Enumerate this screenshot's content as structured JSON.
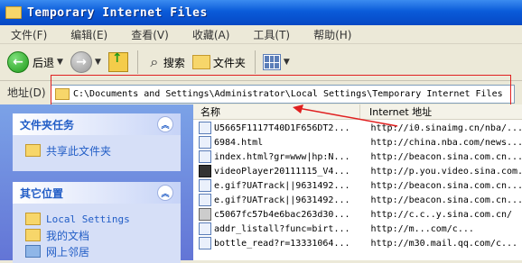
{
  "window": {
    "title": "Temporary Internet Files"
  },
  "menu": [
    "文件(F)",
    "编辑(E)",
    "查看(V)",
    "收藏(A)",
    "工具(T)",
    "帮助(H)"
  ],
  "toolbar": {
    "back_label": "后退",
    "search_label": "搜索",
    "folders_label": "文件夹"
  },
  "address": {
    "label": "地址(D)",
    "path": "C:\\Documents and Settings\\Administrator\\Local Settings\\Temporary Internet Files"
  },
  "tasks": {
    "title": "文件夹任务",
    "items": [
      "共享此文件夹"
    ]
  },
  "places": {
    "title": "其它位置",
    "items": [
      "Local Settings",
      "我的文档",
      "网上邻居"
    ]
  },
  "files": {
    "columns": [
      "名称",
      "Internet 地址"
    ],
    "rows": [
      {
        "name": "U5665F1117T40D1F656DT2...",
        "addr": "http://i0.sinaimg.cn/nba/..."
      },
      {
        "name": "6984.html",
        "addr": "http://china.nba.com/news..."
      },
      {
        "name": "index.html?gr=www|hp:N...",
        "addr": "http://beacon.sina.com.cn..."
      },
      {
        "name": "videoPlayer20111115_V4...",
        "addr": "http://p.you.video.sina.com..."
      },
      {
        "name": "e.gif?UATrack||9631492...",
        "addr": "http://beacon.sina.com.cn..."
      },
      {
        "name": "e.gif?UATrack||9631492...",
        "addr": "http://beacon.sina.com.cn..."
      },
      {
        "name": "c5067fc57b4e6bac263d30...",
        "addr": "http://c.c..y.sina.com.cn/"
      },
      {
        "name": "addr_listall?func=birt...",
        "addr": "http://m...com/c..."
      },
      {
        "name": "bottle_read?r=13331064...",
        "addr": "http://m30.mail.qq.com/c..."
      }
    ]
  }
}
